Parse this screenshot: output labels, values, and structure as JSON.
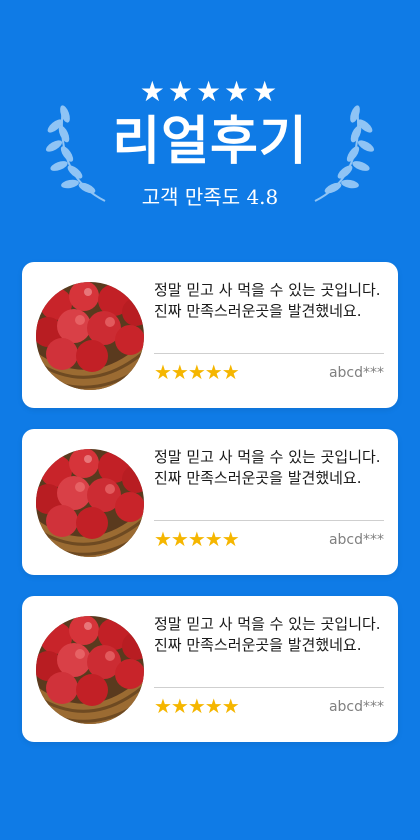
{
  "hero": {
    "stars": "★★★★★",
    "title": "리얼후기",
    "subtitle": "고객 만족도 4.8"
  },
  "colors": {
    "background": "#0f7be6",
    "card": "#ffffff",
    "star": "#f5b600",
    "wreath": "#8fc4f5",
    "apple_red": "#c8242a"
  },
  "reviews": [
    {
      "photo_icon": "apple-basket-photo",
      "text": "정말 믿고 사 먹을 수 있는 곳입니다. 진짜 만족스러운곳을 발견했네요.",
      "rating": "★★★★★",
      "rating_value": 5,
      "user": "abcd***"
    },
    {
      "photo_icon": "apple-basket-photo",
      "text": "정말 믿고 사 먹을 수 있는 곳입니다. 진짜 만족스러운곳을 발견했네요.",
      "rating": "★★★★★",
      "rating_value": 5,
      "user": "abcd***"
    },
    {
      "photo_icon": "apple-basket-photo",
      "text": "정말 믿고 사 먹을 수 있는 곳입니다. 진짜 만족스러운곳을 발견했네요.",
      "rating": "★★★★★",
      "rating_value": 5,
      "user": "abcd***"
    }
  ]
}
